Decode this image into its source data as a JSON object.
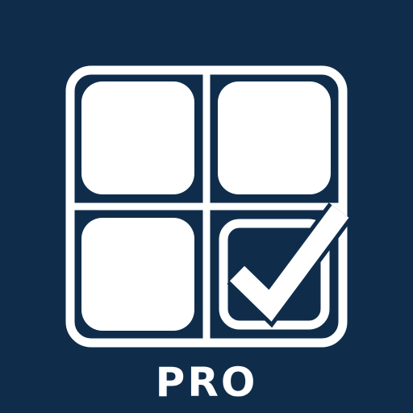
{
  "app_icon": {
    "edition_label": "PRO",
    "icon": "grid-checklist-icon",
    "colors": {
      "background": "#0f2d4b",
      "foreground": "#ffffff"
    },
    "grid": {
      "rows": 2,
      "columns": 2,
      "checked_cell": "bottom-right"
    }
  }
}
